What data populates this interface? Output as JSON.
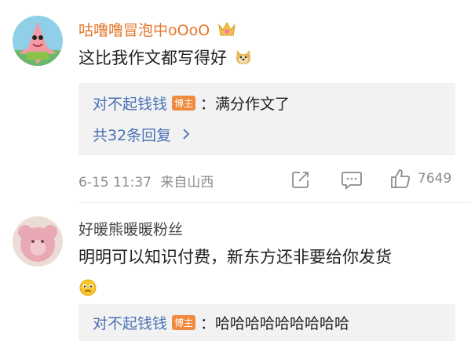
{
  "comments": [
    {
      "username": "咕噜噜冒泡中oOoO",
      "text": "这比我作文都写得好",
      "reply": {
        "name": "对不起钱钱",
        "badge": "博主",
        "text": "：满分作文了"
      },
      "more_replies": "共32条回复",
      "time": "6-15 11:37",
      "location": "来自山西",
      "likes": "7649"
    },
    {
      "username": "好暖熊暖暖粉丝",
      "text": "明明可以知识付费，新东方还非要给你发货",
      "reply": {
        "name": "对不起钱钱",
        "badge": "博主",
        "text": "：哈哈哈哈哈哈哈哈哈"
      }
    }
  ],
  "colors": {
    "username": "#e5772b",
    "link": "#4a72b5",
    "badge": "#f08a3e"
  }
}
